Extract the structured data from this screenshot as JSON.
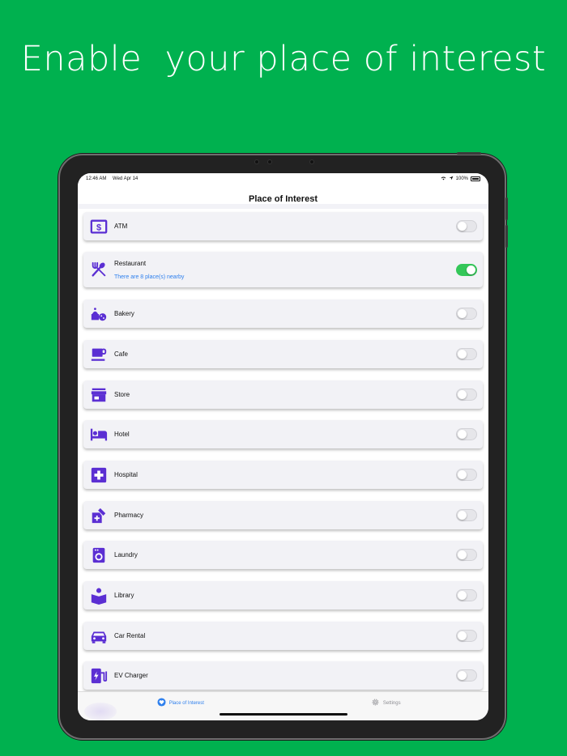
{
  "headline": "Enable  your place of interest",
  "status_bar": {
    "time": "12:46 AM",
    "date": "Wed Apr 14",
    "battery": "100%"
  },
  "nav": {
    "title": "Place of Interest"
  },
  "accent_color": "#5b2fd3",
  "toggle_on_color": "#34c759",
  "items": [
    {
      "label": "ATM",
      "icon": "atm-icon",
      "enabled": false,
      "subtitle": ""
    },
    {
      "label": "Restaurant",
      "icon": "fork-spoon-icon",
      "enabled": true,
      "subtitle": "There are 8 place(s) nearby"
    },
    {
      "label": "Bakery",
      "icon": "bakery-icon",
      "enabled": false,
      "subtitle": ""
    },
    {
      "label": "Cafe",
      "icon": "coffee-cup-icon",
      "enabled": false,
      "subtitle": ""
    },
    {
      "label": "Store",
      "icon": "store-icon",
      "enabled": false,
      "subtitle": ""
    },
    {
      "label": "Hotel",
      "icon": "bed-icon",
      "enabled": false,
      "subtitle": ""
    },
    {
      "label": "Hospital",
      "icon": "medical-cross-icon",
      "enabled": false,
      "subtitle": ""
    },
    {
      "label": "Pharmacy",
      "icon": "pharmacy-icon",
      "enabled": false,
      "subtitle": ""
    },
    {
      "label": "Laundry",
      "icon": "washing-machine-icon",
      "enabled": false,
      "subtitle": ""
    },
    {
      "label": "Library",
      "icon": "reading-person-icon",
      "enabled": false,
      "subtitle": ""
    },
    {
      "label": "Car Rental",
      "icon": "car-icon",
      "enabled": false,
      "subtitle": ""
    },
    {
      "label": "EV Charger",
      "icon": "ev-charger-icon",
      "enabled": false,
      "subtitle": ""
    }
  ],
  "tabs": [
    {
      "label": "Place of Interest",
      "icon": "heart-icon",
      "active": true
    },
    {
      "label": "Settings",
      "icon": "gear-icon",
      "active": false
    }
  ]
}
